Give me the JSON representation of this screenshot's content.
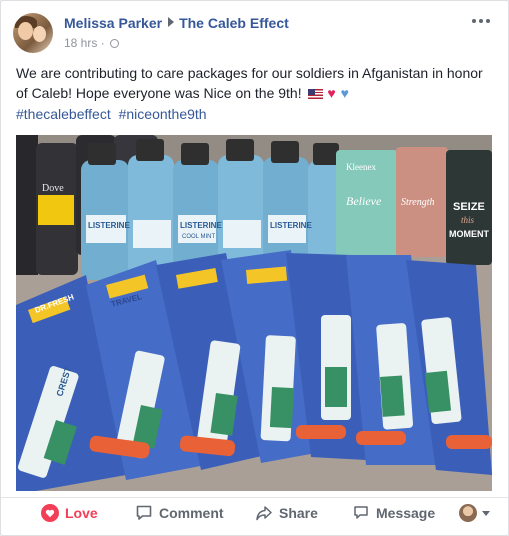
{
  "post": {
    "author": "Melissa Parker",
    "page": "The Caleb Effect",
    "time": "18 hrs",
    "dot": "·",
    "text": "We are contributing to care packages for our soldiers in Afganistan in honor of Caleb! Hope everyone was Nice on the 9th!",
    "emojis": [
      "us-flag-icon",
      "red-heart-icon",
      "blue-heart-icon"
    ],
    "hashtags": [
      "#thecalebeffect",
      "#niceonthe9th"
    ]
  },
  "photo": {
    "labels": {
      "listerine": "LISTERINE",
      "cool_mint": "COOL MINT",
      "kleenex": "Kleenex",
      "believe": "Believe",
      "strength": "Strength",
      "seize": "SEIZE",
      "this": "this",
      "moment": "MOMENT",
      "dove": "Dove",
      "dr_fresh": "DR.FRESH",
      "travel": "TRAVEL",
      "crest": "CREST"
    }
  },
  "actions": {
    "love": "Love",
    "comment": "Comment",
    "share": "Share",
    "message": "Message"
  },
  "colors": {
    "link": "#365899",
    "love": "#f33e58",
    "action": "#606770",
    "meta": "#90949c"
  }
}
